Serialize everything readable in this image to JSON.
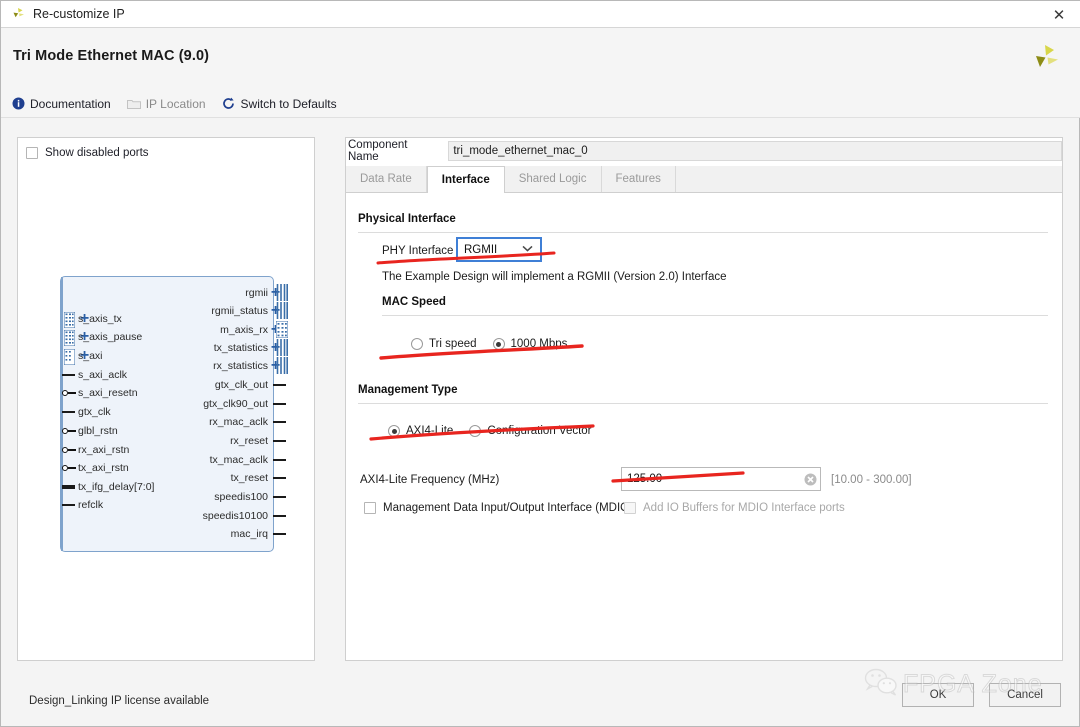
{
  "window": {
    "title": "Re-customize IP",
    "close_label": "✕",
    "app_icon": "xilinx-logo-icon"
  },
  "header": {
    "ip_title": "Tri Mode Ethernet MAC (9.0)",
    "brand_logo": "xilinx-logo-icon"
  },
  "toolbar": {
    "links": [
      {
        "label": "Documentation",
        "icon": "info-icon",
        "disabled": false
      },
      {
        "label": "IP Location",
        "icon": "folder-icon",
        "disabled": true
      },
      {
        "label": "Switch to Defaults",
        "icon": "refresh-icon",
        "disabled": false
      }
    ]
  },
  "left_panel": {
    "show_disabled_ports": {
      "label": "Show disabled ports",
      "checked": false
    },
    "symbol": {
      "left_ports": [
        {
          "name": "s_axis_tx",
          "type": "bus"
        },
        {
          "name": "s_axis_pause",
          "type": "bus"
        },
        {
          "name": "s_axi",
          "type": "bus"
        },
        {
          "name": "s_axi_aclk",
          "type": "clock"
        },
        {
          "name": "s_axi_resetn",
          "type": "inverted"
        },
        {
          "name": "gtx_clk",
          "type": "clock"
        },
        {
          "name": "glbl_rstn",
          "type": "inverted"
        },
        {
          "name": "rx_axi_rstn",
          "type": "inverted"
        },
        {
          "name": "tx_axi_rstn",
          "type": "inverted"
        },
        {
          "name": "tx_ifg_delay[7:0]",
          "type": "vector"
        },
        {
          "name": "refclk",
          "type": "clock"
        }
      ],
      "right_ports": [
        {
          "name": "rgmii",
          "type": "bus"
        },
        {
          "name": "rgmii_status",
          "type": "bus"
        },
        {
          "name": "m_axis_rx",
          "type": "bus"
        },
        {
          "name": "tx_statistics",
          "type": "bus"
        },
        {
          "name": "rx_statistics",
          "type": "bus"
        },
        {
          "name": "gtx_clk_out",
          "type": "signal"
        },
        {
          "name": "gtx_clk90_out",
          "type": "signal"
        },
        {
          "name": "rx_mac_aclk",
          "type": "signal"
        },
        {
          "name": "rx_reset",
          "type": "signal"
        },
        {
          "name": "tx_mac_aclk",
          "type": "signal"
        },
        {
          "name": "tx_reset",
          "type": "signal"
        },
        {
          "name": "speedis100",
          "type": "signal"
        },
        {
          "name": "speedis10100",
          "type": "signal"
        },
        {
          "name": "mac_irq",
          "type": "signal"
        }
      ]
    }
  },
  "right_panel": {
    "component_name": {
      "label": "Component Name",
      "value": "tri_mode_ethernet_mac_0"
    },
    "tabs": [
      {
        "label": "Data Rate",
        "active": false
      },
      {
        "label": "Interface",
        "active": true
      },
      {
        "label": "Shared Logic",
        "active": false
      },
      {
        "label": "Features",
        "active": false
      }
    ],
    "physical_interface": {
      "section_title": "Physical Interface",
      "phy_label": "PHY Interface",
      "phy_value": "RGMII",
      "phy_arrow": "⌄",
      "note": "The Example Design will implement a RGMII (Version 2.0) Interface"
    },
    "mac_speed": {
      "section_title": "MAC Speed",
      "options": [
        {
          "label": "Tri speed",
          "selected": false
        },
        {
          "label": "1000 Mbps",
          "selected": true
        }
      ]
    },
    "management_type": {
      "section_title": "Management Type",
      "options": [
        {
          "label": "AXI4-Lite",
          "selected": true
        },
        {
          "label": "Configuration Vector",
          "selected": false
        }
      ],
      "frequency_label": "AXI4-Lite Frequency (MHz)",
      "frequency_value": "125.00",
      "frequency_range": "[10.00 - 300.00]",
      "mdio_checkbox": {
        "label": "Management Data Input/Output Interface (MDIO)",
        "checked": false,
        "disabled": false
      },
      "mdio_buffers_checkbox": {
        "label": "Add IO Buffers for MDIO Interface ports",
        "checked": false,
        "disabled": true
      }
    }
  },
  "footer": {
    "status": "Design_Linking IP license available",
    "ok_label": "OK",
    "cancel_label": "Cancel"
  },
  "watermark": {
    "text": "FPGA Zone",
    "icon": "wechat-icon"
  },
  "colors": {
    "accent_blue": "#3f7fd6",
    "symbol_fill": "#eef3fa",
    "symbol_border": "#7fa3cc",
    "annotation_red": "#e8251f",
    "brand_yellow": "#c8c626",
    "link_text": "#20212a"
  }
}
